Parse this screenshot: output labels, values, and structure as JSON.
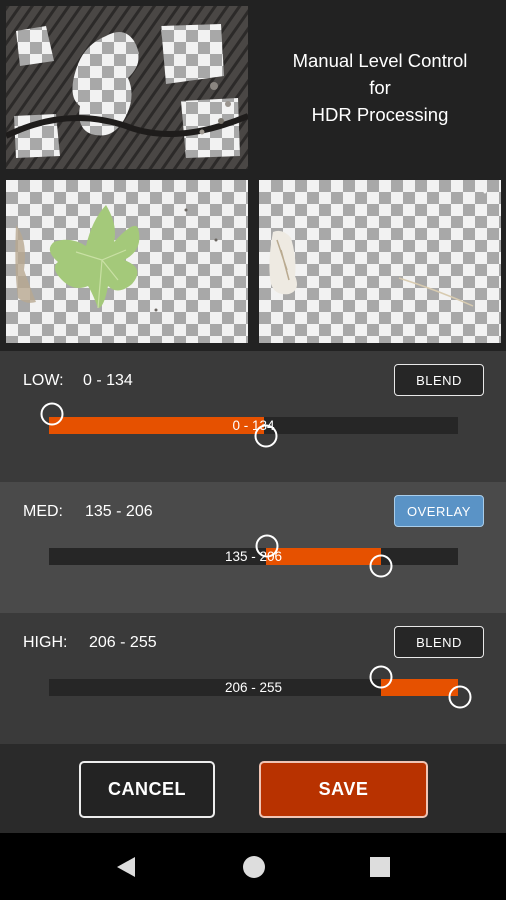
{
  "title": {
    "line1": "Manual Level Control",
    "line2": "for",
    "line3": "HDR Processing"
  },
  "thumbnails": {
    "top": "rock-texture-thumbnail",
    "mid": "leaf-thumbnail",
    "high": "highlights-thumbnail"
  },
  "levels": [
    {
      "label": "LOW:",
      "range": "0 - 134",
      "min": 0,
      "max": 134,
      "mode": "BLEND",
      "mode_active": false
    },
    {
      "label": "MED:",
      "range": "135 - 206",
      "min": 135,
      "max": 206,
      "mode": "OVERLAY",
      "mode_active": true
    },
    {
      "label": "HIGH:",
      "range": "206 - 255",
      "min": 206,
      "max": 255,
      "mode": "BLEND",
      "mode_active": false
    }
  ],
  "actions": {
    "cancel": "CANCEL",
    "save": "SAVE"
  },
  "colors": {
    "accent": "#e65100",
    "save_button": "#b83200",
    "overlay_active": "#5a93c6"
  },
  "nav": {
    "back": "back-icon",
    "home": "home-icon",
    "recents": "recents-icon"
  }
}
